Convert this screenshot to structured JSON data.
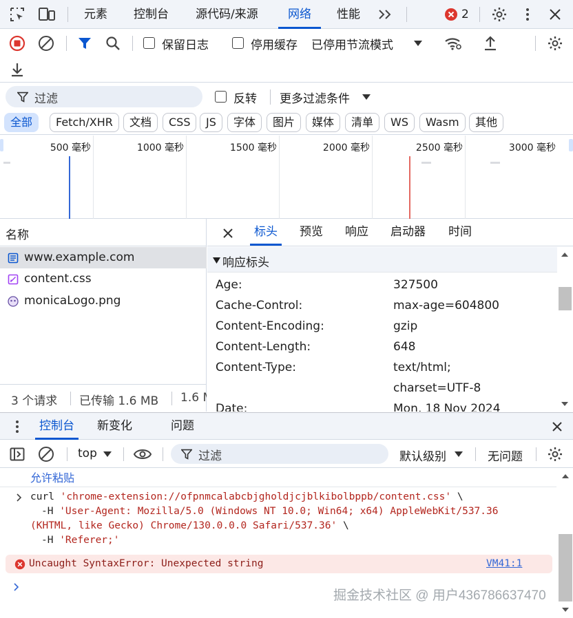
{
  "tabs": {
    "items": [
      "元素",
      "控制台",
      "源代码/来源",
      "网络",
      "性能"
    ],
    "active": "网络",
    "error_count": "2"
  },
  "network_toolbar": {
    "preserve_log": "保留日志",
    "disable_cache": "停用缓存",
    "throttling": "已停用节流模式"
  },
  "filter_bar": {
    "placeholder": "过滤",
    "invert": "反转",
    "more_filters": "更多过滤条件"
  },
  "type_filters": [
    "全部",
    "Fetch/XHR",
    "文档",
    "CSS",
    "JS",
    "字体",
    "图片",
    "媒体",
    "清单",
    "WS",
    "Wasm",
    "其他"
  ],
  "timeline": {
    "ticks": [
      "500 毫秒",
      "1000 毫秒",
      "1500 毫秒",
      "2000 毫秒",
      "2500 毫秒",
      "3000 毫秒"
    ]
  },
  "request_list": {
    "header": "名称",
    "items": [
      "www.example.com",
      "content.css",
      "monicaLogo.png"
    ],
    "status_requests": "3 个请求",
    "status_transferred": "已传输 1.6 MB",
    "status_resources": "1.6 M"
  },
  "detail_tabs": [
    "标头",
    "预览",
    "响应",
    "启动器",
    "时间"
  ],
  "response_headers": {
    "section_title": "响应标头",
    "rows": [
      {
        "key": "Age:",
        "value": "327500"
      },
      {
        "key": "Cache-Control:",
        "value": "max-age=604800"
      },
      {
        "key": "Content-Encoding:",
        "value": "gzip"
      },
      {
        "key": "Content-Length:",
        "value": "648"
      },
      {
        "key": "Content-Type:",
        "value": "text/html;"
      },
      {
        "key": "",
        "value": "charset=UTF-8"
      },
      {
        "key": "Date:",
        "value": "Mon, 18 Nov 2024"
      }
    ]
  },
  "drawer": {
    "tabs": [
      "控制台",
      "新变化",
      "问题"
    ],
    "context": "top",
    "filter_placeholder": "过滤",
    "levels": "默认级别",
    "issues": "无问题"
  },
  "console": {
    "allow_paste": "允许粘贴",
    "curl_cmd": "curl",
    "curl_url": "'chrome-extension://ofpnmcalabcbjgholdjcjblkibolbppb/content.css'",
    "curl_cont": "\\",
    "curl_h1_flag": "-H",
    "curl_h1a": "'User-Agent: Mozilla/5.0 (Windows NT 10.0; Win64; x64) AppleWebKit/537.36",
    "curl_h1b": "(KHTML, like Gecko) Chrome/130.0.0.0 Safari/537.36'",
    "curl_h1b_cont": "\\",
    "curl_h2_flag": "-H",
    "curl_h2": "'Referer;'",
    "error_text": "Uncaught SyntaxError: Unexpected string",
    "error_link": "VM41:1",
    "watermark": "掘金技术社区 @ 用户436786637470"
  },
  "colors": {
    "accent": "#0b57d0",
    "error": "#dc362e",
    "error_bg": "#fce8e6",
    "console_string": "#b3261e"
  }
}
